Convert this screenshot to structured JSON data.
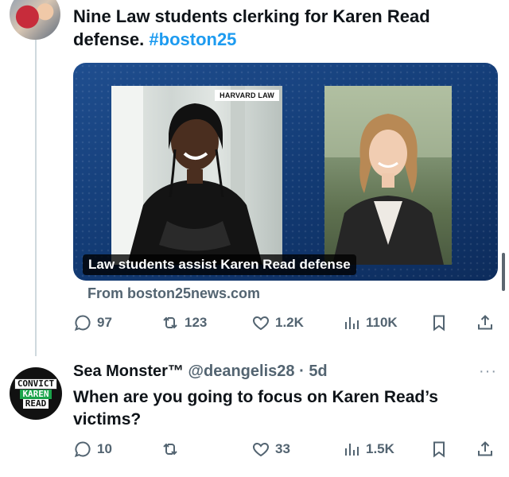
{
  "tweet": {
    "text": "Nine Law students clerking for Karen Read defense.",
    "hashtag": "#boston25",
    "card": {
      "photo_tag": "HARVARD LAW",
      "caption": "Law students assist Karen Read defense",
      "source": "From boston25news.com"
    },
    "actions": {
      "replies": "97",
      "reposts": "123",
      "likes": "1.2K",
      "views": "110K"
    }
  },
  "reply": {
    "avatar_lines": [
      "CONVICT",
      "KAREN",
      "READ"
    ],
    "name": "Sea Monster™",
    "handle": "@deangelis28",
    "separator": "·",
    "time": "5d",
    "more": "···",
    "text": "When are you going to focus on Karen Read’s victims?",
    "actions": {
      "replies": "10",
      "reposts": "",
      "likes": "33",
      "views": "1.5K"
    }
  },
  "icons": {
    "reply": "reply-icon",
    "repost": "repost-icon",
    "like": "heart-icon",
    "views": "views-icon",
    "bookmark": "bookmark-icon",
    "share": "share-icon"
  },
  "colors": {
    "accent": "#1d9bf0",
    "muted": "#536471",
    "card_bg": "#123a73",
    "convict_green": "#1aa34a"
  }
}
